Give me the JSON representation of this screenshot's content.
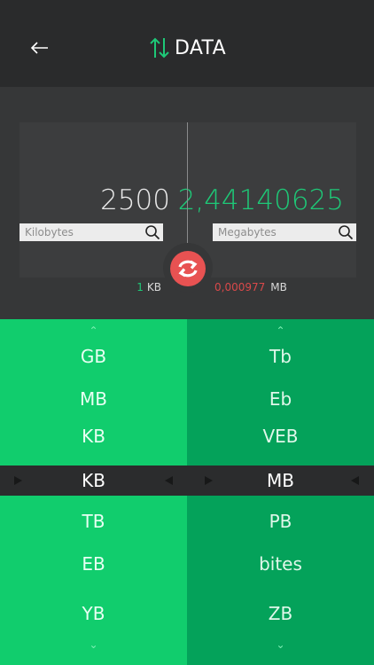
{
  "header": {
    "title": "DATA",
    "back_icon": "arrow-left-icon",
    "title_icon": "up-down-arrows-icon",
    "accent": "#1ec877"
  },
  "converter": {
    "input_value": "2500",
    "output_value": "2,44140625",
    "from_unit": "Kilobytes",
    "to_unit": "Megabytes",
    "from_note_value": "1",
    "from_note_unit": "KB",
    "to_note_value": "0,000977",
    "to_note_unit": "MB",
    "swap_icon": "swap-icon",
    "swap_color": "#e85252",
    "output_color": "#1ec877",
    "note_negative_color": "#d9494a"
  },
  "picker_left": {
    "above": [
      "GB",
      "MB",
      "KB"
    ],
    "selected": "KB",
    "below": [
      "TB",
      "EB",
      "YB"
    ],
    "background": "#11cd6d"
  },
  "picker_right": {
    "above": [
      "Tb",
      "Eb",
      "VEB"
    ],
    "selected": "MB",
    "below": [
      "PB",
      "bites",
      "ZB"
    ],
    "background": "#04a25a"
  }
}
